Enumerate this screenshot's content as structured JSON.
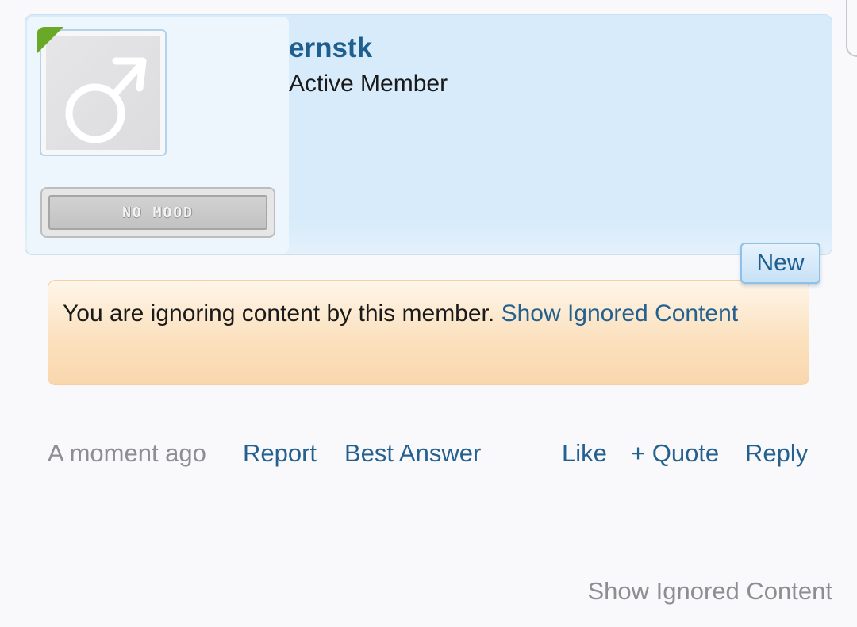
{
  "post": {
    "username": "ernstk",
    "user_title": "Active Member",
    "mood_label": "NO MOOD",
    "avatar_icon": "male-symbol-icon",
    "online_indicator_color": "#6aa827",
    "new_badge": "New"
  },
  "notice": {
    "text": "You are ignoring content by this member.",
    "link_label": "Show Ignored Content"
  },
  "footer": {
    "timestamp": "A moment ago",
    "report": "Report",
    "best_answer": "Best Answer",
    "like": "Like",
    "quote": "+ Quote",
    "reply": "Reply"
  },
  "bottom_link": "Show Ignored Content",
  "colors": {
    "link": "#25618e",
    "username": "#1f5f8f",
    "header_bg": "#d7ebfa",
    "notice_bg": "#fbe1bf",
    "muted_text": "#8e8e92"
  }
}
